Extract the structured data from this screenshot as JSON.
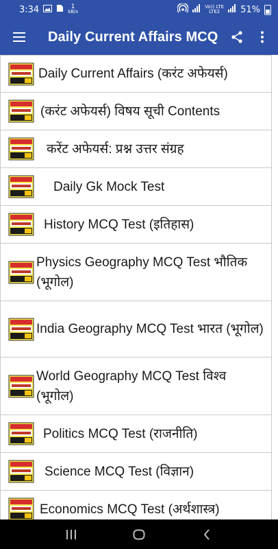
{
  "status": {
    "time": "3:34",
    "data_speed_value": "1",
    "data_speed_unit": "kB/s",
    "network_label_top": "Vo)) LTE",
    "network_label_bottom": "LTE2",
    "lte": "LTE",
    "battery": "51%"
  },
  "app_bar": {
    "title": "Daily Current Affairs MCQ"
  },
  "list": {
    "items": [
      {
        "label": "Daily Current Affairs (करंट अफेयर्स)"
      },
      {
        "label": "(करंट अफेयर्स) विषय सूची Contents"
      },
      {
        "label": "करेंट अफेयर्स: प्रश्न उत्तर संग्रह"
      },
      {
        "label": "Daily Gk Mock Test"
      },
      {
        "label": "History MCQ Test (इतिहास)"
      },
      {
        "label": "Physics Geography MCQ Test भौतिक (भूगोल)"
      },
      {
        "label": "India Geography MCQ Test भारत (भूगोल)"
      },
      {
        "label": "World Geography MCQ Test विश्व (भूगोल)"
      },
      {
        "label": "Politics MCQ Test (राजनीति)"
      },
      {
        "label": "Science MCQ Test (विज्ञान)"
      },
      {
        "label": "Economics MCQ Test (अर्थशास्त्र)"
      }
    ]
  },
  "colors": {
    "primary": "#2f52a8",
    "nav_bar": "#000000",
    "divider": "#c9c9c9"
  },
  "icons": {
    "menu": "hamburger-menu-icon",
    "share": "share-icon",
    "overflow": "more-vert-icon",
    "thumb": "current-affairs-book-icon",
    "nav_recent": "recent-apps-icon",
    "nav_home": "home-icon",
    "nav_back": "back-icon"
  }
}
